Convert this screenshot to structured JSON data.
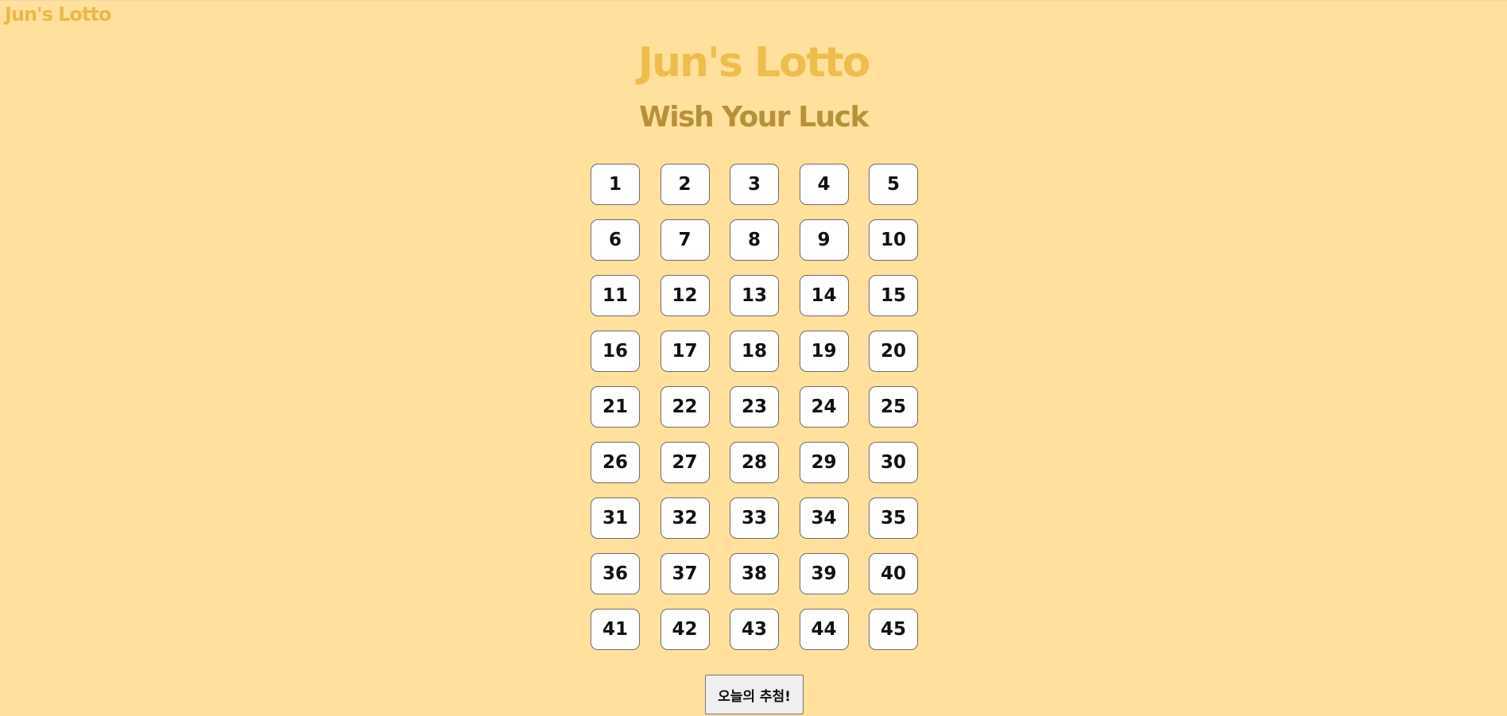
{
  "header": {
    "brand": "Jun's Lotto"
  },
  "main": {
    "title": "Jun's Lotto",
    "subtitle": "Wish Your Luck",
    "numbers": [
      "1",
      "2",
      "3",
      "4",
      "5",
      "6",
      "7",
      "8",
      "9",
      "10",
      "11",
      "12",
      "13",
      "14",
      "15",
      "16",
      "17",
      "18",
      "19",
      "20",
      "21",
      "22",
      "23",
      "24",
      "25",
      "26",
      "27",
      "28",
      "29",
      "30",
      "31",
      "32",
      "33",
      "34",
      "35",
      "36",
      "37",
      "38",
      "39",
      "40",
      "41",
      "42",
      "43",
      "44",
      "45"
    ],
    "recommend_button_label": "오늘의 추첨!"
  },
  "colors": {
    "background": "#FFE09C",
    "brand": "#E8B94A",
    "title": "#EDBE4D",
    "subtitle": "#B9903A"
  }
}
